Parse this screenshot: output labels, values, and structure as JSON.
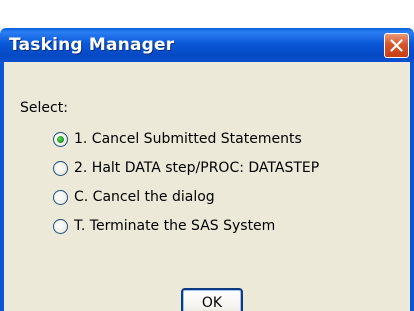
{
  "dialog": {
    "title": "Tasking Manager",
    "close_icon": "close-x-icon",
    "select_label": "Select:",
    "options": [
      {
        "label": "1. Cancel Submitted Statements",
        "selected": true
      },
      {
        "label": "2. Halt DATA step/PROC: DATASTEP",
        "selected": false
      },
      {
        "label": "C. Cancel the dialog",
        "selected": false
      },
      {
        "label": "T. Terminate the SAS System",
        "selected": false
      }
    ],
    "ok_label": "OK"
  },
  "colors": {
    "titlebar": "#0b59d8",
    "client_background": "#ece9d8",
    "close_button": "#d8552b",
    "selected_radio": "#21a121"
  }
}
